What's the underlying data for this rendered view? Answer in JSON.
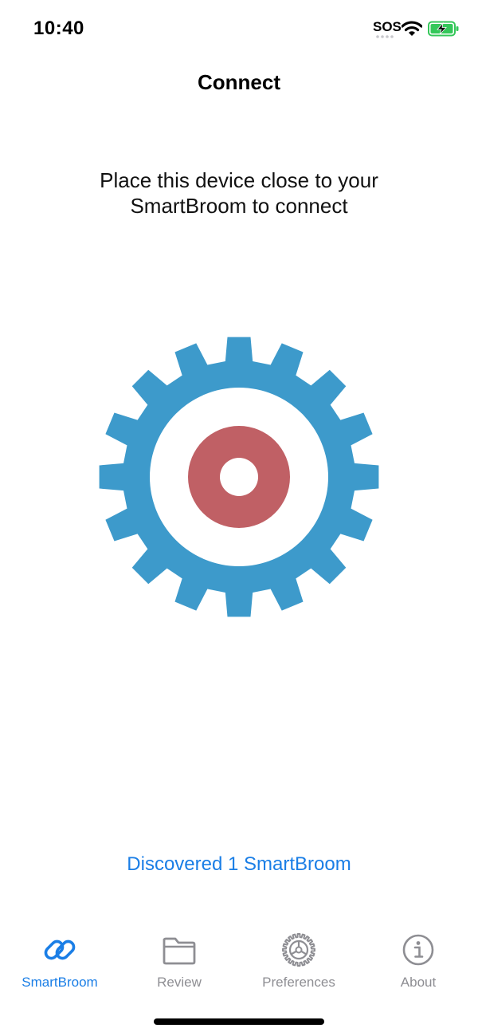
{
  "status_bar": {
    "time": "10:40",
    "sos": "SOS"
  },
  "nav": {
    "title": "Connect"
  },
  "instruction": "Place this device close to your SmartBroom to connect",
  "graphic": {
    "gear_color": "#3d9acb",
    "target_color": "#c06065"
  },
  "discovered_text": "Discovered 1 SmartBroom",
  "tabs": [
    {
      "label": "SmartBroom",
      "icon": "link-icon",
      "active": true
    },
    {
      "label": "Review",
      "icon": "folder-icon",
      "active": false
    },
    {
      "label": "Preferences",
      "icon": "gear-icon",
      "active": false
    },
    {
      "label": "About",
      "icon": "info-icon",
      "active": false
    }
  ],
  "colors": {
    "accent": "#1a7ee6",
    "inactive": "#8e8e93",
    "battery_green": "#34c759"
  }
}
